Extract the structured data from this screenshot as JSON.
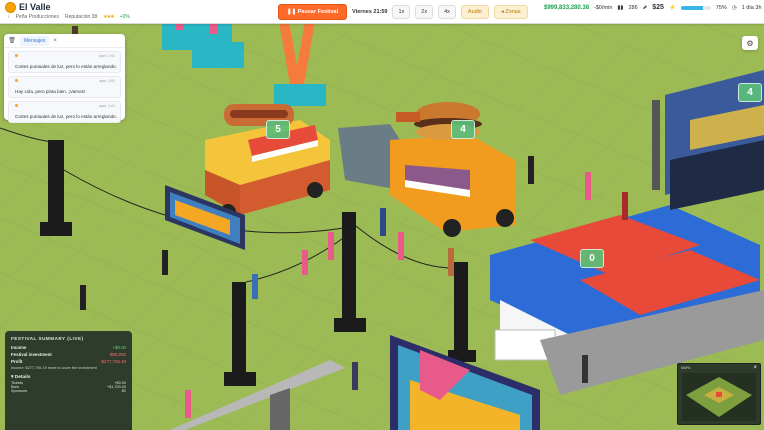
{
  "app": {
    "title": "El Valle",
    "subtitle": "Peña Producciones",
    "reputation_label": "Reputación 38",
    "reputation_stars": "★★★",
    "trend": "+0%"
  },
  "controls": {
    "pause_label": "Pausar Festival",
    "day_label": "Viernes 21:59",
    "speed_1": "1x",
    "speed_2": "2x",
    "speed_4": "4x",
    "audio_label": "Audio",
    "zones_label": "Zonas"
  },
  "stats": {
    "cash": "$999,833,280.38",
    "rate": "-$0/min",
    "guests": "286",
    "coins": "$25",
    "meter_pct": 0.75,
    "meter_label": "75%",
    "time_left": "1 día 3h"
  },
  "messages": {
    "tab_label": "Mensajes",
    "items": [
      {
        "time": "ayer, 1:01",
        "text": "Cortes puntuales de luz, pero lo están arreglando."
      },
      {
        "time": "ayer, 1:01",
        "text": "Hay cola, pero pinta bien. ¡Vamos!"
      },
      {
        "time": "ayer, 1:01",
        "text": "Cortes puntuales de luz, pero lo están arreglando."
      }
    ]
  },
  "badges": {
    "b1": "5",
    "b2": "4",
    "b3": "0",
    "b4": "4"
  },
  "summary": {
    "title": "FESTIVAL SUMMARY (LIVE)",
    "income_label": "Income",
    "income_value": "+$0.00",
    "investment_label": "Festival investment",
    "investment_value": "-$80,000",
    "profit_label": "Profit",
    "profit_value": "-$277,706.19",
    "note": "Income: $277,706.19 more to cover the investment",
    "details_label": "Details",
    "rows": [
      {
        "label": "Tickets",
        "value": "+$0.00"
      },
      {
        "label": "Bars",
        "value": "+$1,700.00"
      },
      {
        "label": "Sponsors",
        "value": "$0"
      }
    ]
  },
  "minimap": {
    "title": "MAPA"
  }
}
